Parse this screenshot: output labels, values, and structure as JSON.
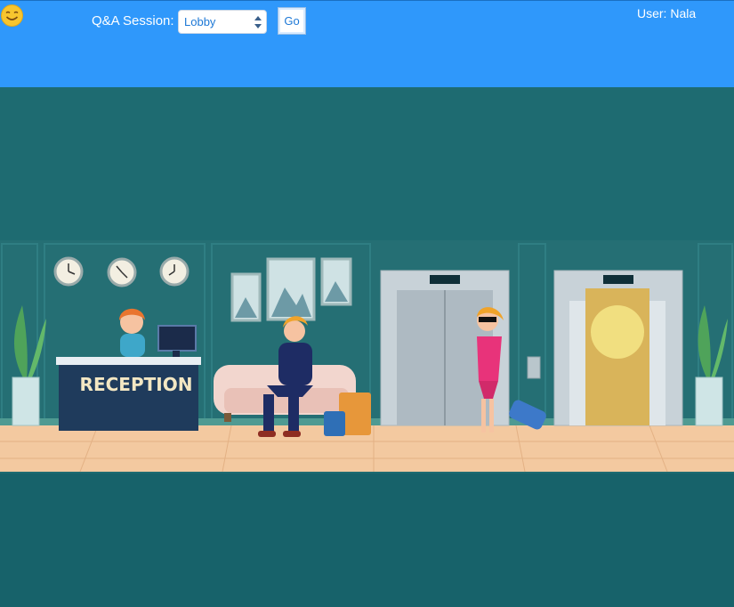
{
  "header": {
    "session_label": "Q&A Session:",
    "session_select": {
      "value": "Lobby"
    },
    "go_label": "Go",
    "user_label": "User: Nala"
  },
  "scene": {
    "reception_sign": "RECEPTION",
    "icons": [
      "smiley-icon",
      "clock-icon",
      "elevator-icon"
    ]
  },
  "colors": {
    "header_bg": "#2f98fb",
    "scene_wall": "#1f6e73",
    "floor": "#f3c9a0",
    "page_bg": "#17626a"
  }
}
